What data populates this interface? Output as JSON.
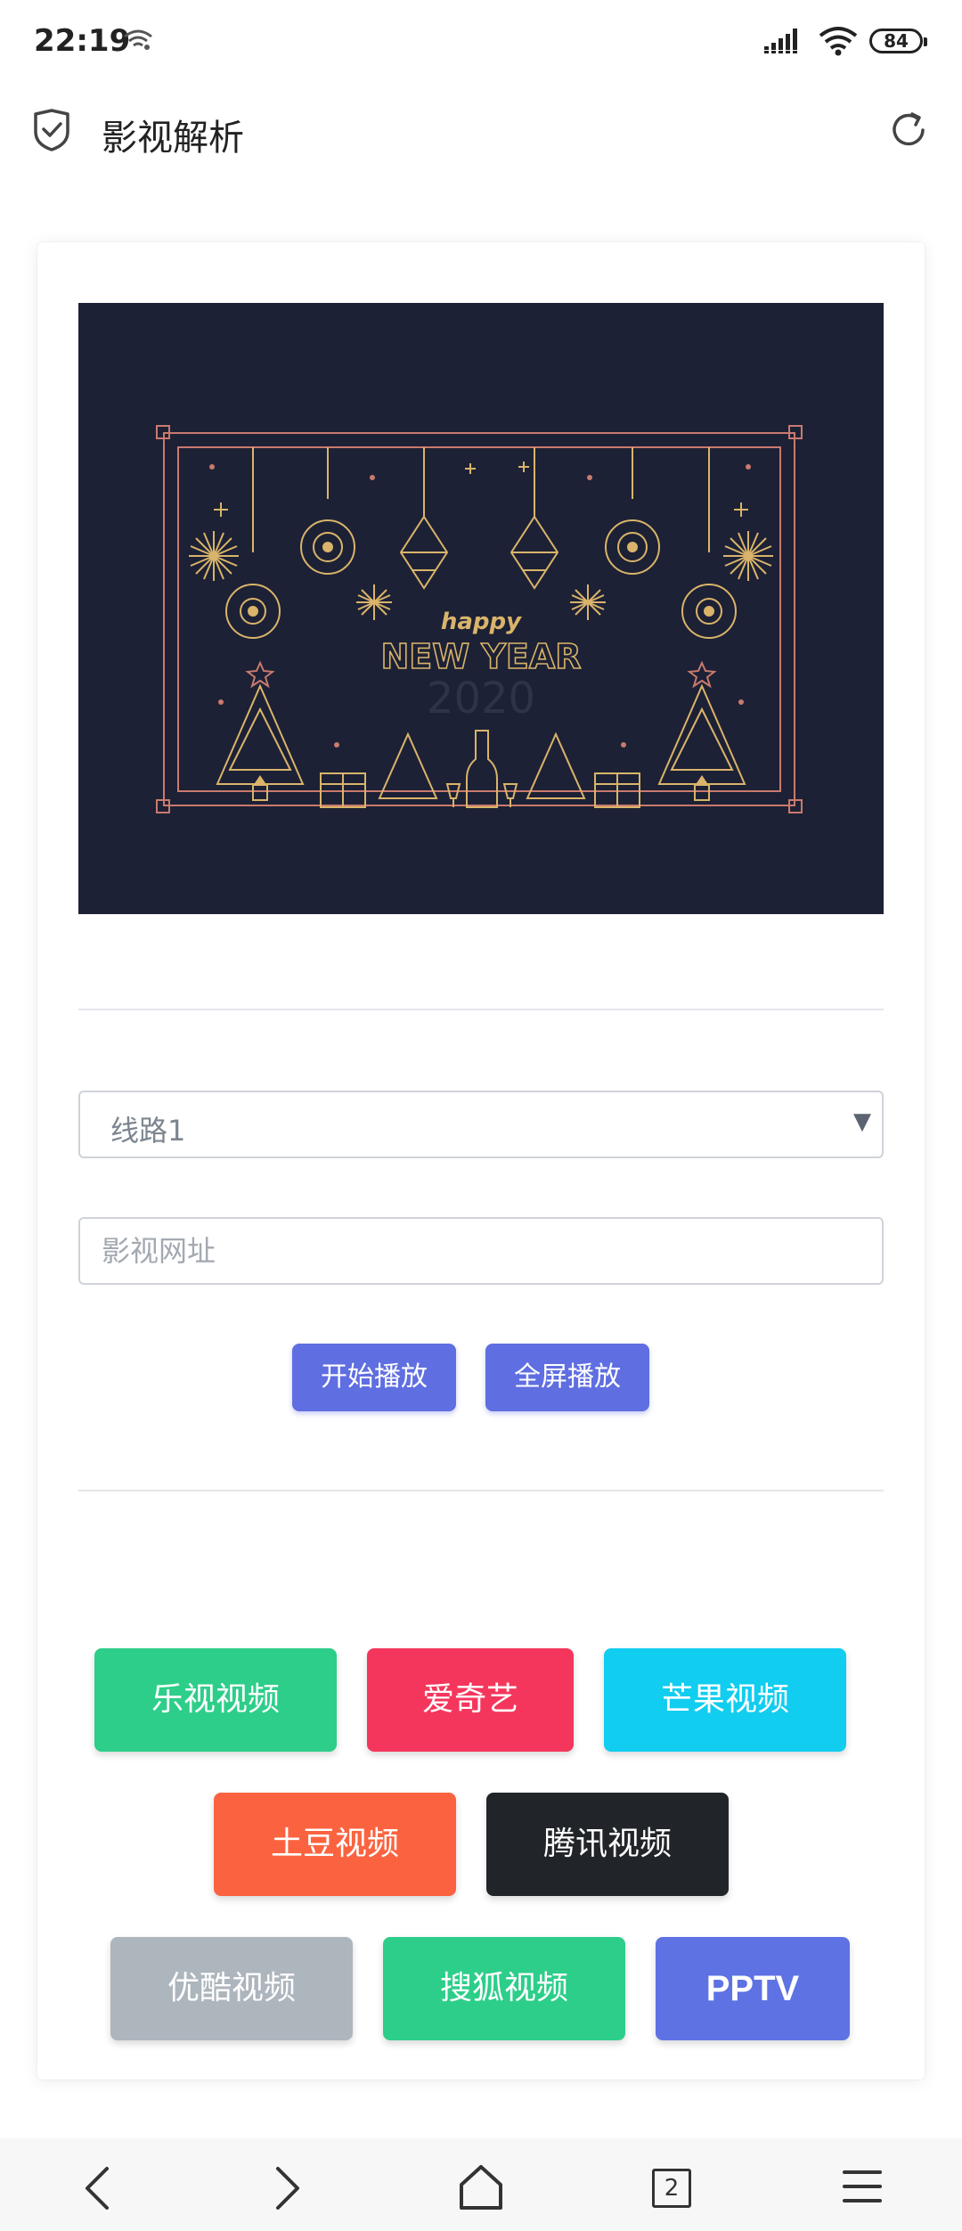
{
  "status_bar": {
    "time": "22:19",
    "battery": "84",
    "icons": [
      "wifi-small-icon",
      "signal-icon",
      "wifi-icon",
      "battery-icon"
    ]
  },
  "app_bar": {
    "title": "影视解析",
    "icons": [
      "shield-check-icon",
      "refresh-icon"
    ]
  },
  "banner": {
    "text_happy": "happy",
    "text_new_year": "NEW YEAR",
    "text_year": "2020",
    "colors": {
      "background": "#1d2135",
      "gold": "#d9b46a",
      "rose": "#c97a6e"
    }
  },
  "form": {
    "route_selected": "线路1",
    "url_placeholder": "影视网址",
    "play_label": "开始播放",
    "fullscreen_label": "全屏播放",
    "accent": "#5f6ee0"
  },
  "platforms": [
    {
      "label": "乐视视频",
      "color": "#2dce89"
    },
    {
      "label": "爱奇艺",
      "color": "#f5365c"
    },
    {
      "label": "芒果视频",
      "color": "#11cdef"
    },
    {
      "label": "土豆视频",
      "color": "#fb6340"
    },
    {
      "label": "腾讯视频",
      "color": "#212529"
    },
    {
      "label": "优酷视频",
      "color": "#adb5bd"
    },
    {
      "label": "搜狐视频",
      "color": "#2dce89"
    },
    {
      "label": "PPTV",
      "color": "#5e72e4"
    }
  ],
  "bottom_nav": {
    "tab_count": "2",
    "icons": [
      "back-icon",
      "forward-icon",
      "home-icon",
      "tabs-icon",
      "menu-icon"
    ]
  }
}
